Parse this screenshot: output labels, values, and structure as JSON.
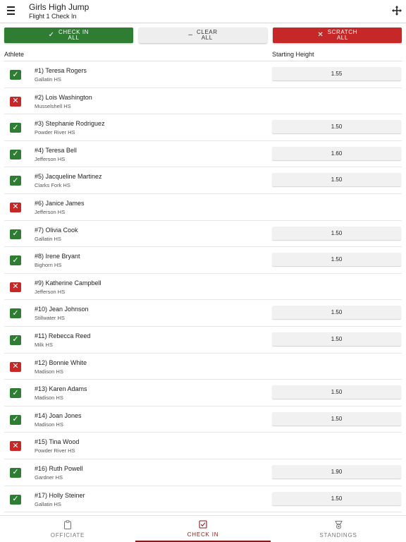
{
  "header": {
    "title": "Girls High Jump",
    "subtitle": "Flight 1 Check In",
    "menu_icon": "menu-icon",
    "move_icon": "move-icon"
  },
  "actions": [
    {
      "label_line1": "CHECK IN",
      "label_line2": "ALL",
      "symbol": "✓",
      "color": "#2e7d32"
    },
    {
      "label_line1": "CLEAR",
      "label_line2": "ALL",
      "symbol": "–",
      "color": "#eeeeee"
    },
    {
      "label_line1": "SCRATCH",
      "label_line2": "ALL",
      "symbol": "✕",
      "color": "#c62828"
    }
  ],
  "columns": {
    "athlete": "Athlete",
    "starting_height": "Starting Height"
  },
  "athletes": [
    {
      "name": "#1) Teresa Rogers",
      "school": "Gallatin HS",
      "status": "in",
      "height": "1.55"
    },
    {
      "name": "#2) Lois Washington",
      "school": "Musselshell HS",
      "status": "out",
      "height": ""
    },
    {
      "name": "#3) Stephanie Rodriguez",
      "school": "Powder River HS",
      "status": "in",
      "height": "1.50"
    },
    {
      "name": "#4) Teresa Bell",
      "school": "Jefferson HS",
      "status": "in",
      "height": "1.60"
    },
    {
      "name": "#5) Jacqueline Martinez",
      "school": "Clarks Fork HS",
      "status": "in",
      "height": "1.50"
    },
    {
      "name": "#6) Janice James",
      "school": "Jefferson HS",
      "status": "out",
      "height": ""
    },
    {
      "name": "#7) Olivia Cook",
      "school": "Gallatin HS",
      "status": "in",
      "height": "1.50"
    },
    {
      "name": "#8) Irene Bryant",
      "school": "Bighorn HS",
      "status": "in",
      "height": "1.50"
    },
    {
      "name": "#9) Katherine Campbell",
      "school": "Jefferson HS",
      "status": "out",
      "height": ""
    },
    {
      "name": "#10) Jean Johnson",
      "school": "Stillwater HS",
      "status": "in",
      "height": "1.50"
    },
    {
      "name": "#11) Rebecca Reed",
      "school": "Milk HS",
      "status": "in",
      "height": "1.50"
    },
    {
      "name": "#12) Bonnie White",
      "school": "Madison HS",
      "status": "out",
      "height": ""
    },
    {
      "name": "#13) Karen Adams",
      "school": "Madison HS",
      "status": "in",
      "height": "1.50"
    },
    {
      "name": "#14) Joan Jones",
      "school": "Madison HS",
      "status": "in",
      "height": "1.50"
    },
    {
      "name": "#15) Tina Wood",
      "school": "Powder River HS",
      "status": "out",
      "height": ""
    },
    {
      "name": "#16) Ruth Powell",
      "school": "Gardner HS",
      "status": "in",
      "height": "1.90"
    },
    {
      "name": "#17) Holly Steiner",
      "school": "Gallatin HS",
      "status": "in",
      "height": "1.50"
    }
  ],
  "colors": {
    "checked_in": "#2e7d32",
    "scratched": "#c62828",
    "accent": "#8b1a1a"
  },
  "nav": [
    {
      "label": "OFFICIATE",
      "icon": "clipboard-icon",
      "active": false
    },
    {
      "label": "CHECK IN",
      "icon": "checkbox-icon",
      "active": true
    },
    {
      "label": "STANDINGS",
      "icon": "podium-icon",
      "active": false
    }
  ]
}
